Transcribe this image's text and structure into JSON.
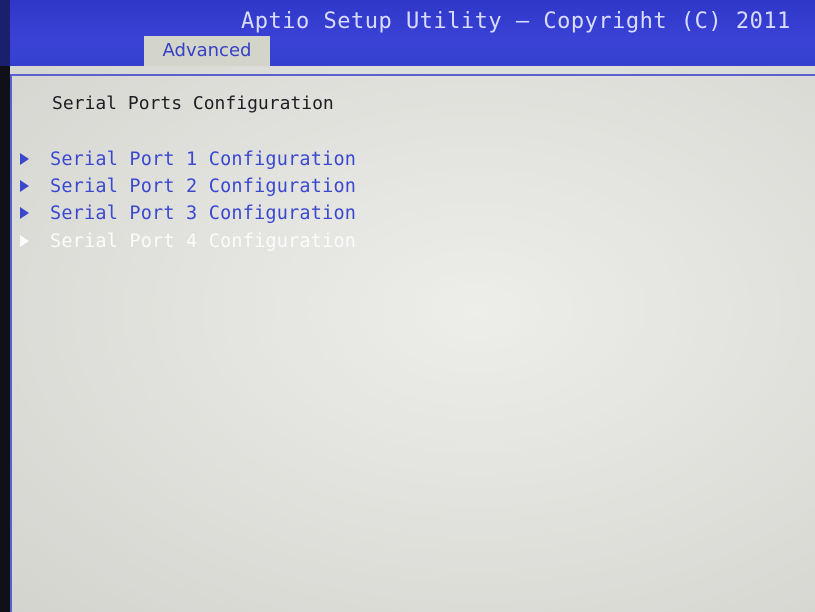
{
  "header": {
    "title": "Aptio Setup Utility – Copyright (C) 2011",
    "active_tab": "Advanced"
  },
  "page": {
    "title": "Serial Ports Configuration"
  },
  "menu": {
    "items": [
      {
        "label": "Serial Port 1 Configuration",
        "selected": false
      },
      {
        "label": "Serial Port 2 Configuration",
        "selected": false
      },
      {
        "label": "Serial Port 3 Configuration",
        "selected": false
      },
      {
        "label": "Serial Port 4 Configuration",
        "selected": true
      }
    ]
  },
  "icons": {
    "submenu": "arrow-right-icon"
  },
  "colors": {
    "title_bar": "#3a42d6",
    "tab_background": "#d3d4ca",
    "panel": "#e3e3df",
    "menu_item_text": "#3a48d0",
    "selected_item_text": "#fbfbfb",
    "heading_text": "#1e1e22"
  }
}
